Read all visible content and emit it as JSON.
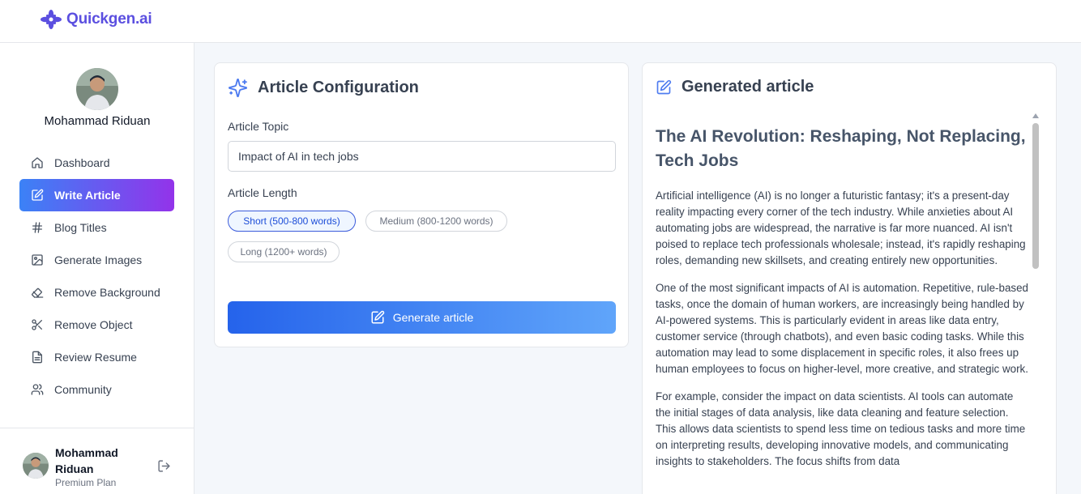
{
  "app": {
    "name": "Quickgen.ai",
    "brand_color": "#5b4fe0"
  },
  "user": {
    "name": "Mohammad Riduan",
    "plan": "Premium Plan"
  },
  "sidebar": {
    "items": [
      {
        "label": "Dashboard",
        "icon": "house-icon",
        "active": false
      },
      {
        "label": "Write Article",
        "icon": "edit-square-icon",
        "active": true
      },
      {
        "label": "Blog Titles",
        "icon": "hash-icon",
        "active": false
      },
      {
        "label": "Generate Images",
        "icon": "image-icon",
        "active": false
      },
      {
        "label": "Remove Background",
        "icon": "eraser-icon",
        "active": false
      },
      {
        "label": "Remove Object",
        "icon": "scissors-icon",
        "active": false
      },
      {
        "label": "Review Resume",
        "icon": "file-text-icon",
        "active": false
      },
      {
        "label": "Community",
        "icon": "users-icon",
        "active": false
      }
    ]
  },
  "config": {
    "title": "Article Configuration",
    "topic_label": "Article Topic",
    "topic_value": "Impact of AI in tech jobs",
    "length_label": "Article Length",
    "lengths": [
      {
        "label": "Short (500-800 words)",
        "selected": true
      },
      {
        "label": "Medium (800-1200 words)",
        "selected": false
      },
      {
        "label": "Long (1200+ words)",
        "selected": false
      }
    ],
    "button_label": "Generate article"
  },
  "article": {
    "panel_title": "Generated article",
    "title": "The AI Revolution: Reshaping, Not Replacing, Tech Jobs",
    "paragraphs": [
      "Artificial intelligence (AI) is no longer a futuristic fantasy; it's a present-day reality impacting every corner of the tech industry. While anxieties about AI automating jobs are widespread, the narrative is far more nuanced. AI isn't poised to replace tech professionals wholesale; instead, it's rapidly reshaping roles, demanding new skillsets, and creating entirely new opportunities.",
      "One of the most significant impacts of AI is automation. Repetitive, rule-based tasks, once the domain of human workers, are increasingly being handled by AI-powered systems. This is particularly evident in areas like data entry, customer service (through chatbots), and even basic coding tasks. While this automation may lead to some displacement in specific roles, it also frees up human employees to focus on higher-level, more creative, and strategic work.",
      "For example, consider the impact on data scientists. AI tools can automate the initial stages of data analysis, like data cleaning and feature selection. This allows data scientists to spend less time on tedious tasks and more time on interpreting results, developing innovative models, and communicating insights to stakeholders. The focus shifts from data"
    ]
  },
  "colors": {
    "active_gradient_start": "#3b82f6",
    "active_gradient_end": "#9333ea",
    "button_gradient_start": "#2563eb",
    "button_gradient_end": "#60a5fa"
  }
}
